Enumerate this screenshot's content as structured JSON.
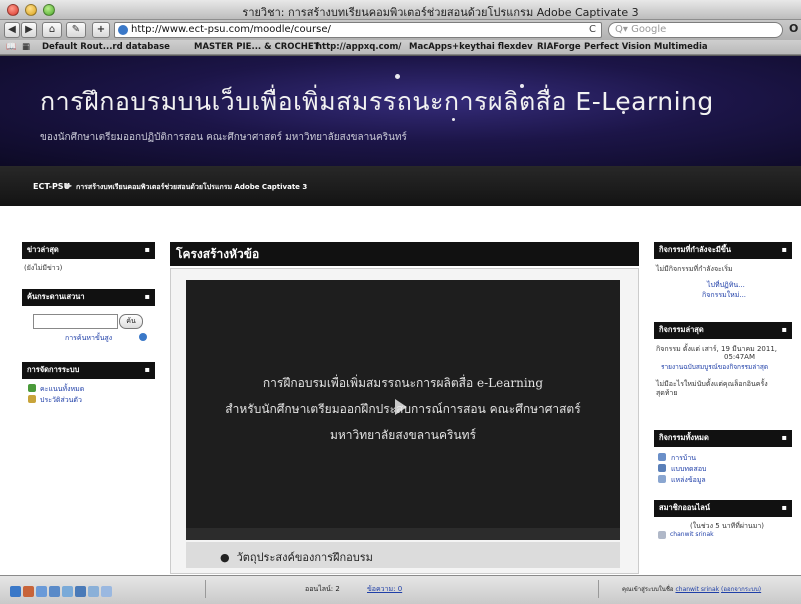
{
  "window": {
    "title": "รายวิชา: การสร้างบทเรียนคอมพิวเตอร์ช่วยสอนด้วยโปรแกรม Adobe Captivate 3"
  },
  "toolbar": {
    "back": "◀",
    "forward": "▶",
    "home": "⌂",
    "bookmark": "✎",
    "add": "+",
    "url": "http://www.ect-psu.com/moodle/course/",
    "reload": "C",
    "search_placeholder": "Q▾ Google",
    "end_label": "O"
  },
  "bookmarks": [
    "Default Rout...rd database",
    "MASTER PIE... & CROCHET",
    "http://appxq.com/",
    "MacApps+key",
    "thai flexdev",
    "RIAForge",
    "Perfect Vision Multimedia"
  ],
  "banner": {
    "title": "การฝึกอบรมบนเว็บเพื่อเพิ่มสมรรถนะการผลิตสื่อ E-Learning",
    "subtitle": "ของนักศึกษาเตรียมออกปฏิบัติการสอน คณะศึกษาศาสตร์ มหาวิทยาลัยสงขลานครินทร์"
  },
  "breadcrumb": {
    "root": "ECT-PSU",
    "separator": "▶",
    "current": "การสร้างบทเรียนคอมพิวเตอร์ช่วยสอนด้วยโปรแกรม Adobe Captivate 3"
  },
  "left": {
    "news": {
      "title": "ข่าวล่าสุด",
      "empty": "(ยังไม่มีข่าว)"
    },
    "search": {
      "title": "ค้นกระดานเสวนา",
      "button": "ค้น",
      "advanced": "การค้นหาขั้นสูง"
    },
    "admin": {
      "title": "การจัดการระบบ",
      "items": [
        "คะแนนทั้งหมด",
        "ประวัติส่วนตัว"
      ]
    }
  },
  "main": {
    "title": "โครงสร้างหัวข้อ",
    "video_lines": [
      "การฝึกอบรมเพื่อเพิ่มสมรรถนะการผลิตสื่อ e-Learning",
      "สำหรับนักศึกษาเตรียมออกฝึกประสบการณ์การสอน คณะศึกษาศาสตร์",
      "มหาวิทยาลัยสงขลานครินทร์"
    ],
    "outline_item": "วัตถุประสงค์ของการฝึกอบรม"
  },
  "right": {
    "upcoming": {
      "title": "กิจกรรมที่กำลังจะมีขึ้น",
      "empty": "ไม่มีกิจกรรมที่กำลังจะเริ่ม",
      "links": [
        "ไปที่ปฏิทิน...",
        "กิจกรรมใหม่..."
      ]
    },
    "recent": {
      "title": "กิจกรรมล่าสุด",
      "since_line1": "กิจกรรม ตั้งแต่ เสาร์, 19 มีนาคม 2011,",
      "since_line2": "05:47AM",
      "full_report": "รายงานฉบับสมบูรณ์ของกิจกรรมล่าสุด",
      "none_line1": "ไม่มีอะไรใหม่นับตั้งแต่คุณล็อกอินครั้ง",
      "none_line2": "สุดท้าย"
    },
    "all": {
      "title": "กิจกรรมทั้งหมด",
      "items": [
        "การบ้าน",
        "แบบทดสอบ",
        "แหล่งข้อมูล"
      ]
    },
    "online": {
      "title": "สมาชิกออนไลน์",
      "period": "(ในช่วง 5 นาทีที่ผ่านมา)",
      "user": "chanwit srinak"
    }
  },
  "statusbar": {
    "online_label": "ออนไลน์: 2",
    "messages_label": "ข้อความ: 0",
    "login_prefix": "คุณเข้าสู่ระบบในชื่อ",
    "login_user": "chanwit srinak",
    "logout": "(ออกจากระบบ)"
  },
  "colors": {
    "banner_bg": "#1c1548",
    "block_header": "#111111",
    "link": "#1f3fa8"
  }
}
